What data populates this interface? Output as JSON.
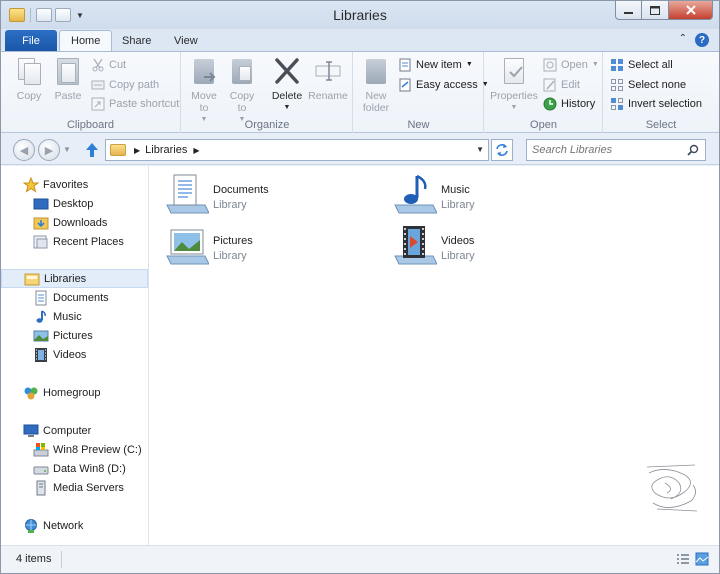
{
  "window": {
    "title": "Libraries"
  },
  "ribbon_tabs": [
    {
      "label": "File"
    },
    {
      "label": "Home"
    },
    {
      "label": "Share"
    },
    {
      "label": "View"
    }
  ],
  "ribbon": {
    "clipboard": {
      "label": "Clipboard",
      "copy": "Copy",
      "paste": "Paste",
      "cut": "Cut",
      "copy_path": "Copy path",
      "paste_shortcut": "Paste shortcut"
    },
    "organize": {
      "label": "Organize",
      "move_to": "Move to",
      "copy_to": "Copy to",
      "delete": "Delete",
      "rename": "Rename"
    },
    "new": {
      "label": "New",
      "new_folder": "New folder",
      "new_item": "New item",
      "easy_access": "Easy access"
    },
    "open": {
      "label": "Open",
      "properties": "Properties",
      "open": "Open",
      "edit": "Edit",
      "history": "History"
    },
    "select": {
      "label": "Select",
      "select_all": "Select all",
      "select_none": "Select none",
      "invert_selection": "Invert selection"
    }
  },
  "address_bar": {
    "path": "Libraries",
    "search_placeholder": "Search Libraries"
  },
  "nav_pane": {
    "favorites": {
      "label": "Favorites",
      "items": [
        "Desktop",
        "Downloads",
        "Recent Places"
      ]
    },
    "libraries": {
      "label": "Libraries",
      "items": [
        "Documents",
        "Music",
        "Pictures",
        "Videos"
      ]
    },
    "homegroup": {
      "label": "Homegroup"
    },
    "computer": {
      "label": "Computer",
      "items": [
        "Win8 Preview (C:)",
        "Data Win8 (D:)",
        "Media Servers"
      ]
    },
    "network": {
      "label": "Network"
    }
  },
  "libraries": [
    {
      "name": "Documents",
      "type": "Library",
      "icon": "documents-library-icon"
    },
    {
      "name": "Music",
      "type": "Library",
      "icon": "music-library-icon"
    },
    {
      "name": "Pictures",
      "type": "Library",
      "icon": "pictures-library-icon"
    },
    {
      "name": "Videos",
      "type": "Library",
      "icon": "videos-library-icon"
    }
  ],
  "status": {
    "item_count": "4 items"
  },
  "colors": {
    "accent": "#1a56a8",
    "selection": "#e2edf9"
  }
}
